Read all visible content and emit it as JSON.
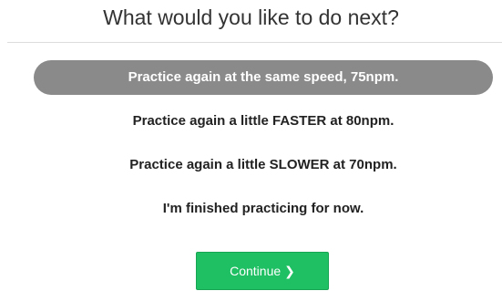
{
  "header": {
    "title": "What would you like to do next?"
  },
  "options": [
    {
      "label": "Practice again at the same speed, 75npm.",
      "selected": true
    },
    {
      "label": "Practice again a little FASTER at 80npm.",
      "selected": false
    },
    {
      "label": "Practice again a little SLOWER at 70npm.",
      "selected": false
    },
    {
      "label": "I'm finished practicing for now.",
      "selected": false
    }
  ],
  "continue_button": {
    "label": "Continue",
    "icon": "chevron-right-icon",
    "glyph": "❯",
    "color": "#1fbf63"
  },
  "colors": {
    "selected_option_bg": "#8a8a8a",
    "divider": "#dddddd"
  }
}
